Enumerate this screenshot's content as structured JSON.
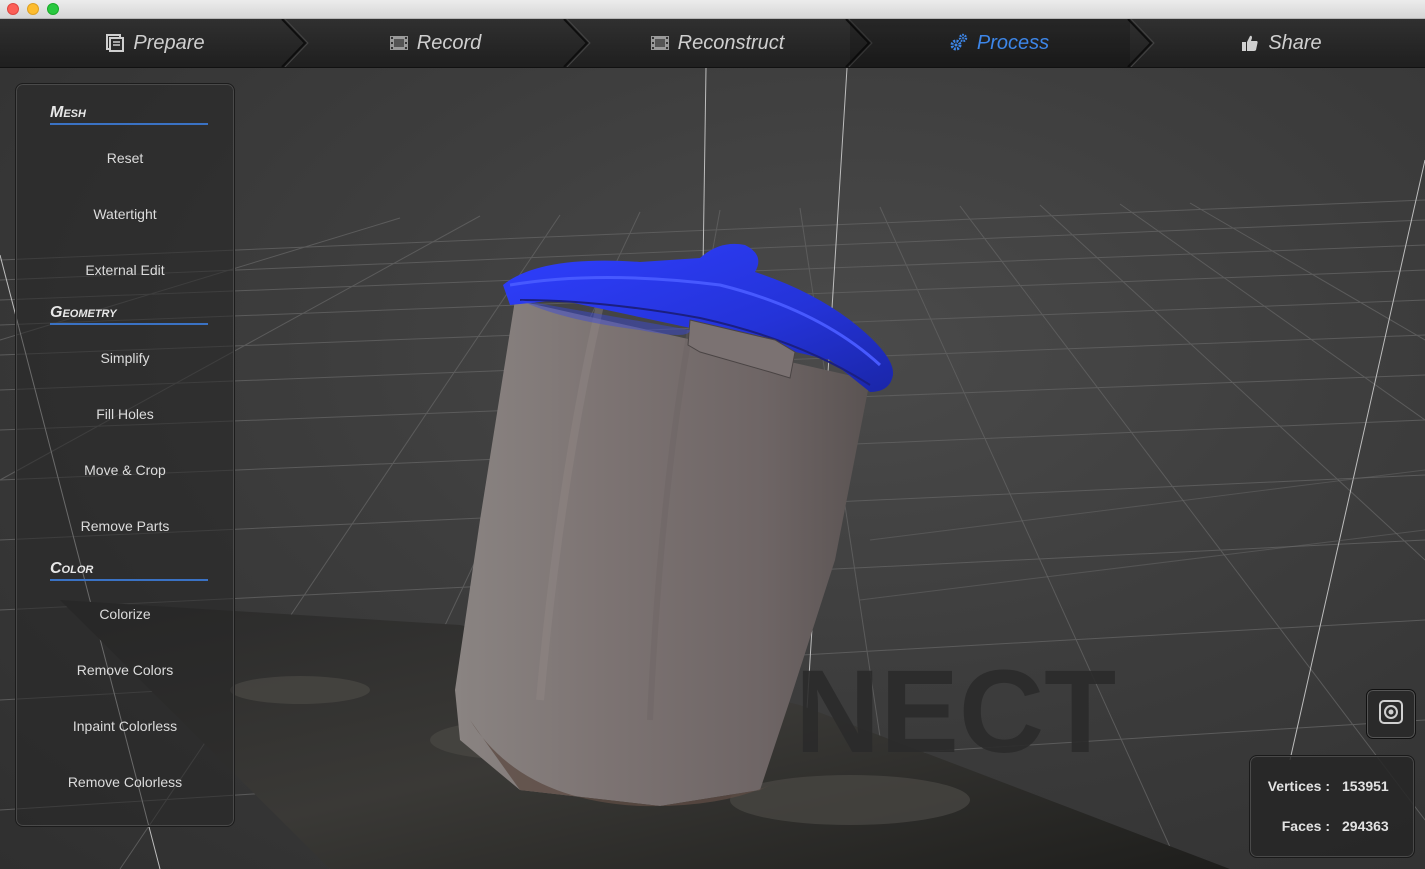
{
  "window": {
    "traffic_lights": [
      "close",
      "minimize",
      "zoom"
    ]
  },
  "toolbar": {
    "tabs": [
      {
        "label": "Prepare",
        "icon": "prepare-icon",
        "active": false
      },
      {
        "label": "Record",
        "icon": "film-icon",
        "active": false
      },
      {
        "label": "Reconstruct",
        "icon": "film-icon",
        "active": false
      },
      {
        "label": "Process",
        "icon": "gears-icon",
        "active": true
      },
      {
        "label": "Share",
        "icon": "thumbs-up-icon",
        "active": false
      }
    ],
    "active_color": "#3d86e8"
  },
  "sidebar": {
    "sections": [
      {
        "title": "Mesh",
        "items": [
          "Reset",
          "Watertight",
          "External Edit"
        ]
      },
      {
        "title": "Geometry",
        "items": [
          "Simplify",
          "Fill Holes",
          "Move & Crop",
          "Remove Parts"
        ]
      },
      {
        "title": "Color",
        "items": [
          "Colorize",
          "Remove Colors",
          "Inpaint Colorless",
          "Remove Colorless"
        ]
      }
    ]
  },
  "viewport": {
    "watermark": "NECT",
    "object": "scanned-trash-can-mesh",
    "camera_button_icon": "snapshot-icon"
  },
  "stats": {
    "vertices_label": "Vertices :",
    "vertices_value": "153951",
    "faces_label": "Faces :",
    "faces_value": "294363"
  }
}
